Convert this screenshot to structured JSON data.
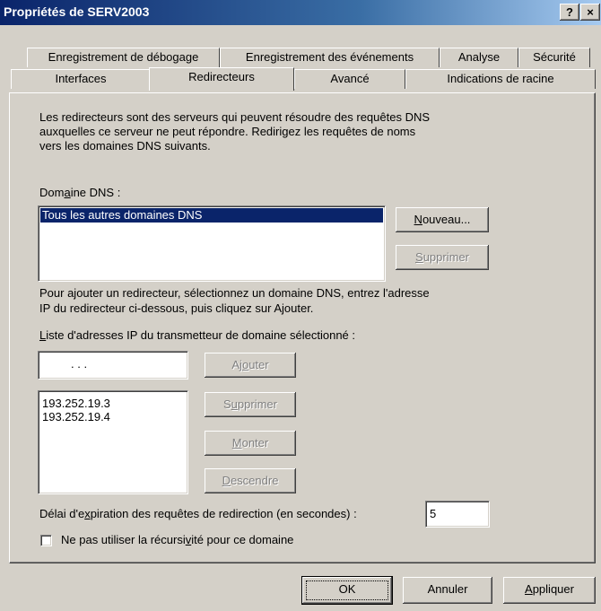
{
  "window": {
    "title": "Propriétés de SERV2003",
    "help_button": "?",
    "close_button": "×"
  },
  "tabs": {
    "row_top": [
      "Enregistrement de débogage",
      "Enregistrement des événements",
      "Analyse",
      "Sécurité"
    ],
    "row_bottom": [
      "Interfaces",
      "Redirecteurs",
      "Avancé",
      "Indications de racine"
    ],
    "active": "Redirecteurs"
  },
  "panel": {
    "description": [
      "Les redirecteurs sont des serveurs qui peuvent résoudre des requêtes DNS",
      "auxquelles ce serveur ne peut répondre. Redirigez les requêtes de noms",
      "vers les domaines DNS suivants."
    ],
    "dns_domain_label_pre": "Dom",
    "dns_domain_label_ul": "a",
    "dns_domain_label_post": "ine DNS :",
    "dns_domains": [
      "Tous les autres domaines DNS"
    ],
    "new_button_ul": "N",
    "new_button_rest": "ouveau...",
    "delete_domain_button_ul": "S",
    "delete_domain_button_rest": "upprimer",
    "add_instructions": [
      "Pour ajouter un redirecteur, sélectionnez un domaine DNS, entrez l'adresse",
      "IP du redirecteur ci-dessous, puis cliquez sur Ajouter."
    ],
    "ip_list_label_ul": "L",
    "ip_list_label_rest": "iste d'adresses IP du transmetteur de domaine sélectionné :",
    "ip_input_dots": ".          .          .",
    "add_button_pre": "Aj",
    "add_button_ul": "o",
    "add_button_post": "uter",
    "ip_addresses": [
      "193.252.19.3",
      "193.252.19.4"
    ],
    "remove_ip_button_pre": "S",
    "remove_ip_button_ul": "u",
    "remove_ip_button_post": "pprimer",
    "up_button_ul": "M",
    "up_button_rest": "onter",
    "down_button_ul": "D",
    "down_button_rest": "escendre",
    "timeout_label_pre": "Délai d'e",
    "timeout_label_ul": "x",
    "timeout_label_post": "piration des requêtes de redirection (en secondes) :",
    "timeout_value": "5",
    "recursion_label_pre": "Ne pas utiliser la récursi",
    "recursion_label_ul": "v",
    "recursion_label_post": "ité pour ce domaine",
    "recursion_checked": false
  },
  "footer": {
    "ok": "OK",
    "cancel": "Annuler",
    "apply_ul": "A",
    "apply_rest": "ppliquer"
  }
}
